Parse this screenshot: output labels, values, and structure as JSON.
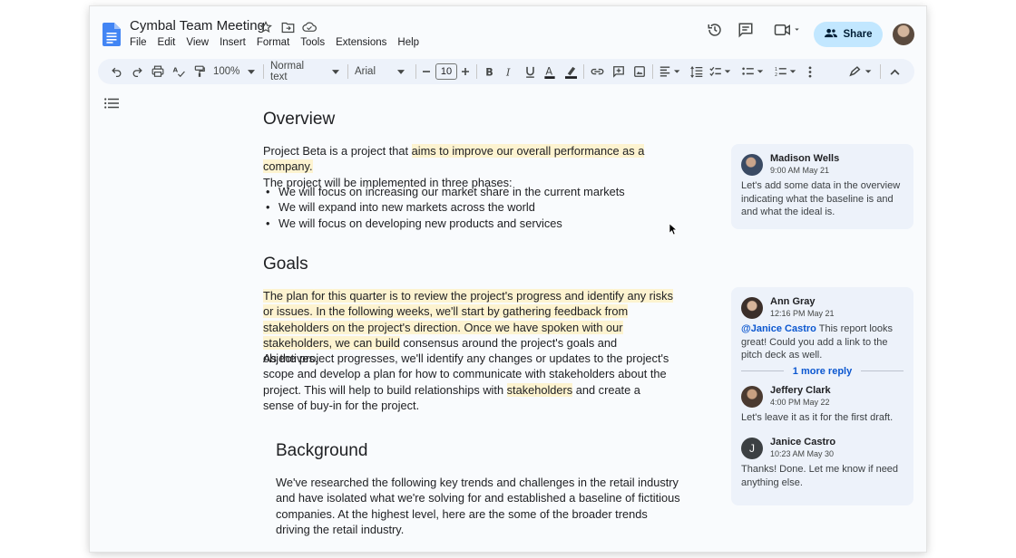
{
  "app": {
    "doc_title": "Cymbal Team Meeting",
    "share_label": "Share",
    "menu": [
      "File",
      "Edit",
      "View",
      "Insert",
      "Format",
      "Tools",
      "Extensions",
      "Help"
    ]
  },
  "toolbar": {
    "zoom": "100%",
    "paragraph_style": "Normal text",
    "font_family": "Arial",
    "font_size": "10"
  },
  "document": {
    "overview": {
      "heading": "Overview",
      "intro_plain": "Project Beta is a project that ",
      "intro_highlight": "aims to improve our overall performance as a company.",
      "intro_line2": "The project will be implemented in three phases:",
      "bullets": [
        "We will focus on increasing our market share in the current markets",
        "We will expand into new markets across the world",
        "We will focus on developing new products and services"
      ]
    },
    "goals": {
      "heading": "Goals",
      "highlight": "The plan for this quarter is to review the project's progress and identify any risks or issues. In the following weeks, we'll start by gathering feedback from stakeholders on the project's direction. Once we have spoken with our stakeholders, we can build",
      "after_highlight": " consensus around the project's goals and objectives.",
      "para2_a": "As the project progresses, we'll identify any changes or updates to the project's scope and develop a plan for how to communicate with stakeholders about the project. This will help to build relationships with ",
      "para2_hl": "stakeholders",
      "para2_b": " and create a sense of buy-in for the project."
    },
    "background": {
      "heading": "Background",
      "text": "We've researched the following key trends and challenges in the retail industry and have isolated what we're solving for and established a baseline of fictitious companies. At the highest level, here are the some of the broader trends driving the retail industry."
    }
  },
  "comments": [
    {
      "author": "Madison Wells",
      "time": "9:00 AM May 21",
      "text": "Let's add some data in the overview indicating what the baseline is and and what the ideal is."
    },
    {
      "author": "Ann Gray",
      "time": "12:16 PM May 21",
      "mention": "@Janice Castro",
      "text": " This report looks great! Could you add a link to the pitch deck as well.",
      "more_reply": "1 more reply",
      "replies": [
        {
          "author": "Jeffery Clark",
          "time": "4:00 PM May 22",
          "text": "Let's leave it as it for the first draft."
        },
        {
          "author": "Janice Castro",
          "initial": "J",
          "time": "10:23 AM May 30",
          "text": "Thanks! Done. Let me know if need anything else."
        }
      ]
    }
  ]
}
